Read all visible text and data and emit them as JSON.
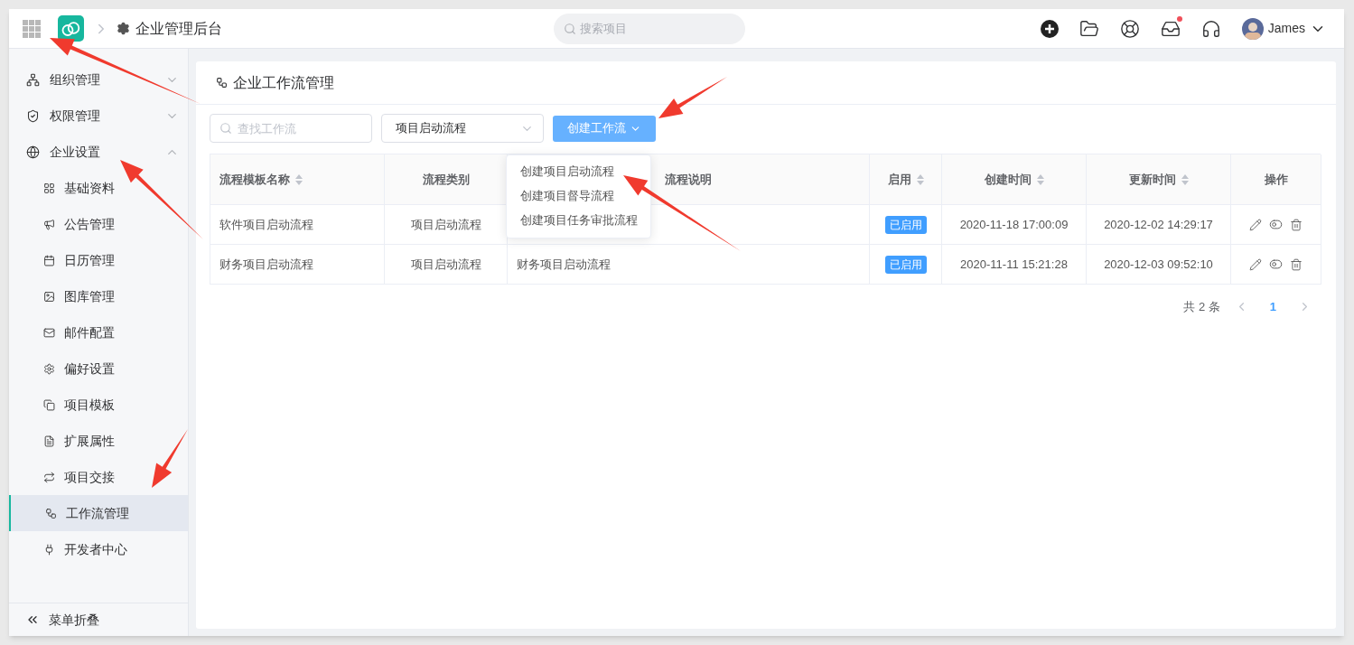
{
  "topbar": {
    "breadcrumb": "企业管理后台",
    "search": {
      "placeholder": "搜索项目"
    },
    "notification_dot": true,
    "user": {
      "name": "James"
    }
  },
  "sidebar": {
    "items": [
      {
        "label": "组织管理",
        "expanded": false,
        "selected": false
      },
      {
        "label": "权限管理",
        "expanded": false,
        "selected": false
      },
      {
        "label": "企业设置",
        "expanded": true,
        "selected": false,
        "children": [
          {
            "label": "基础资料",
            "selected": false
          },
          {
            "label": "公告管理",
            "selected": false
          },
          {
            "label": "日历管理",
            "selected": false
          },
          {
            "label": "图库管理",
            "selected": false
          },
          {
            "label": "邮件配置",
            "selected": false
          },
          {
            "label": "偏好设置",
            "selected": false
          },
          {
            "label": "项目模板",
            "selected": false
          },
          {
            "label": "扩展属性",
            "selected": false
          },
          {
            "label": "项目交接",
            "selected": false
          },
          {
            "label": "工作流管理",
            "selected": true
          },
          {
            "label": "开发者中心",
            "selected": false
          }
        ]
      }
    ],
    "collapse_label": "菜单折叠"
  },
  "page": {
    "title": "企业工作流管理",
    "search": {
      "placeholder": "查找工作流"
    },
    "category_select": {
      "value": "项目启动流程"
    },
    "create_button": {
      "label": "创建工作流",
      "expanded": true,
      "menu": [
        {
          "label": "创建项目启动流程"
        },
        {
          "label": "创建项目督导流程"
        },
        {
          "label": "创建项目任务审批流程"
        }
      ]
    },
    "table": {
      "columns": [
        {
          "label": "流程模板名称",
          "sortable": true
        },
        {
          "label": "流程类别",
          "sortable": false
        },
        {
          "label": "流程说明",
          "sortable": false
        },
        {
          "label": "启用",
          "sortable": true
        },
        {
          "label": "创建时间",
          "sortable": true
        },
        {
          "label": "更新时间",
          "sortable": true
        },
        {
          "label": "操作",
          "sortable": false
        }
      ],
      "rows": [
        {
          "name": "软件项目启动流程",
          "category": "项目启动流程",
          "enabled": true,
          "status": "已启用",
          "created": "2020-11-18 17:00:09",
          "updated": "2020-12-02 14:29:17"
        },
        {
          "name": "财务项目启动流程",
          "category": "项目启动流程",
          "description": "财务项目启动流程",
          "enabled": true,
          "status": "已启用",
          "created": "2020-11-11 15:21:28",
          "updated": "2020-12-03 09:52:10"
        }
      ]
    },
    "pagination": {
      "total": "共 2 条",
      "pages": [
        {
          "label": "1",
          "selected": true
        }
      ]
    }
  }
}
